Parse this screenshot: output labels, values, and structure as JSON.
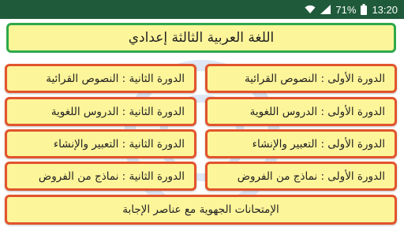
{
  "status_bar": {
    "battery_percent": "71%",
    "time": "13:20",
    "icons": [
      "wifi-icon",
      "signal-icon",
      "battery-icon"
    ]
  },
  "app": {
    "title": "اللغة العربية الثالثة إعدادي"
  },
  "menu": {
    "items": [
      {
        "label": "الدورة الأولى : النصوص القرائية"
      },
      {
        "label": "الدورة الثانية : النصوص القرائية"
      },
      {
        "label": "الدورة الأولى : الدروس اللغوية"
      },
      {
        "label": "الدورة الثانية : الدروس اللغوية"
      },
      {
        "label": "الدورة الأولى : التعبير والإنشاء"
      },
      {
        "label": "الدورة الثانية : التعبير والإنشاء"
      },
      {
        "label": "الدورة الأولى : نماذج من الفروض"
      },
      {
        "label": "الدورة الثانية : نماذج من الفروض"
      }
    ],
    "exams_label": "الإمتحانات الجهوية مع عناصر الإجابة"
  },
  "colors": {
    "status_bar_bg": "#1f5b3a",
    "button_fill": "#fdf59a",
    "title_border": "#2fa84b",
    "button_border": "#e2542c"
  }
}
